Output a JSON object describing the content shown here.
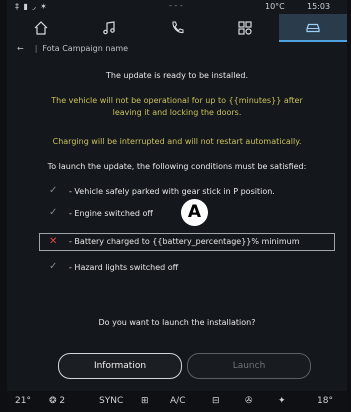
{
  "status": {
    "left_icons": "‡ ▮ ◞ ✶",
    "center": "- - -",
    "temperature": "10°C",
    "time": "15:03"
  },
  "tabs": [
    {
      "icon": "home-icon"
    },
    {
      "icon": "music-icon"
    },
    {
      "icon": "phone-icon"
    },
    {
      "icon": "apps-icon"
    },
    {
      "icon": "car-icon",
      "active": true
    }
  ],
  "breadcrumb": {
    "arrow": "←",
    "separator": "|",
    "title": "Fota Campaign name"
  },
  "messages": {
    "ready": "The update is ready to be installed.",
    "not_operational_1": "The vehicle will not be operational for up to {{minutes}} after",
    "not_operational_2": "leaving it and locking the doors.",
    "charging": "Charging will be interrupted and will not restart automatically.",
    "conditions_intro": "To launch the update, the following conditions must be satisfied:",
    "question": "Do you want to launch the installation?"
  },
  "conditions": [
    {
      "text": "- Vehicle safely parked with gear stick in P position.",
      "ok": true
    },
    {
      "text": "- Engine switched off",
      "ok": true
    },
    {
      "text": "- Battery charged to {{battery_percentage}}% minimum",
      "ok": false
    },
    {
      "text": "- Hazard lights switched off",
      "ok": true
    }
  ],
  "marker": "A",
  "buttons": {
    "information": "Information",
    "launch": "Launch"
  },
  "bottom_bar": {
    "temp_left": "21°",
    "seat": "❂ 2",
    "sync": "SYNC",
    "ac": "A/C",
    "temp_right": "18°"
  },
  "colors": {
    "accent": "#4fa3e0",
    "warning": "#c9c25a",
    "error": "#e0454b"
  }
}
